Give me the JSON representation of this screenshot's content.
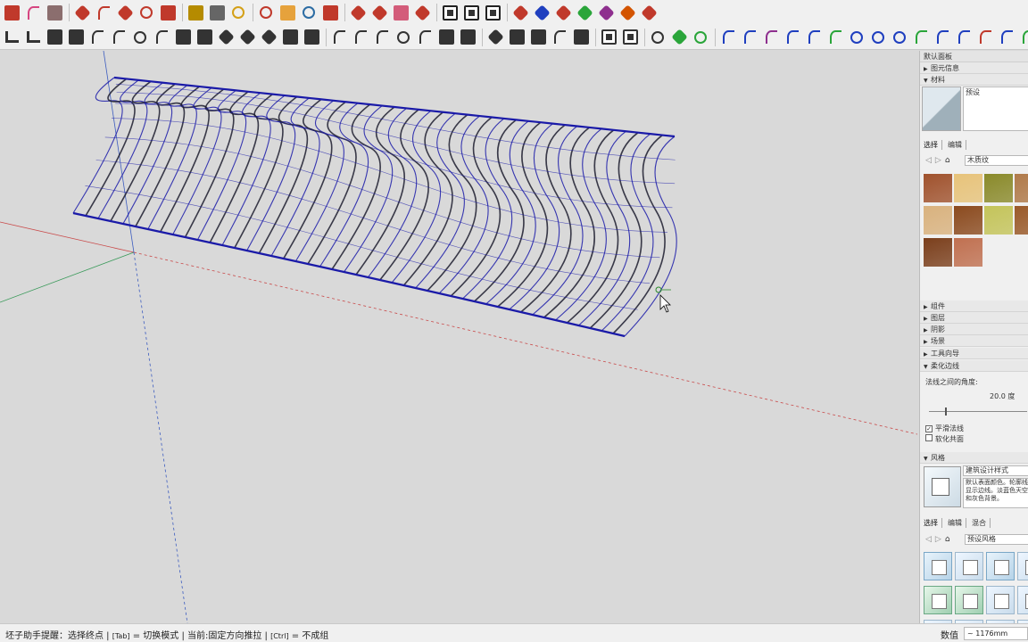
{
  "toolbar_row1": [
    {
      "name": "pencil-icon",
      "color": "#c0392b",
      "shape": "sq"
    },
    {
      "name": "arc-icon",
      "color": "#d64580",
      "shape": "curve"
    },
    {
      "name": "eraser-icon",
      "color": "#8b6e6e",
      "shape": "sq"
    },
    {
      "sep": true
    },
    {
      "name": "push-pull-icon",
      "color": "#c0392b",
      "shape": "gem"
    },
    {
      "name": "follow-me-icon",
      "color": "#c0392b",
      "shape": "curve"
    },
    {
      "name": "move-icon",
      "color": "#c0392b",
      "shape": "gem"
    },
    {
      "name": "rotate-icon",
      "color": "#c0392b",
      "shape": "ring"
    },
    {
      "name": "scale-icon",
      "color": "#c0392b",
      "shape": "sq"
    },
    {
      "sep": true
    },
    {
      "name": "tape-measure-icon",
      "color": "#b58b00",
      "shape": "sq"
    },
    {
      "name": "text-icon",
      "color": "#666666",
      "shape": "sq"
    },
    {
      "name": "paint-bucket-icon",
      "color": "#d4a017",
      "shape": "ring"
    },
    {
      "sep": true
    },
    {
      "name": "orbit-icon",
      "color": "#c0392b",
      "shape": "ring"
    },
    {
      "name": "pan-icon",
      "color": "#e6a23c",
      "shape": "sq"
    },
    {
      "name": "zoom-icon",
      "color": "#2c6ca3",
      "shape": "ring"
    },
    {
      "name": "zoom-extents-icon",
      "color": "#c0392b",
      "shape": "sq"
    },
    {
      "sep": true
    },
    {
      "name": "ruby-script-icon",
      "color": "#c0392b",
      "shape": "gem"
    },
    {
      "name": "ruby-console-icon",
      "color": "#c0392b",
      "shape": "gem"
    },
    {
      "name": "ruby-window-icon",
      "color": "#d35c7a",
      "shape": "sq"
    },
    {
      "name": "ruby-gem-icon",
      "color": "#c0392b",
      "shape": "gem"
    },
    {
      "sep": true
    },
    {
      "name": "grid-view-icon",
      "color": "#222222",
      "shape": "boxed"
    },
    {
      "name": "ring-view-icon",
      "color": "#222222",
      "shape": "boxed"
    },
    {
      "name": "model-view-icon",
      "color": "#222222",
      "shape": "boxed"
    },
    {
      "sep": true
    },
    {
      "name": "extension-1-icon",
      "color": "#c0392b",
      "shape": "gem"
    },
    {
      "name": "extension-2-icon",
      "color": "#1f3fbf",
      "shape": "gem"
    },
    {
      "name": "extension-3-icon",
      "color": "#c0392b",
      "shape": "gem"
    },
    {
      "name": "extension-4-icon",
      "color": "#2aa53a",
      "shape": "gem"
    },
    {
      "name": "extension-5-icon",
      "color": "#8e2f8e",
      "shape": "gem"
    },
    {
      "name": "extension-6-icon",
      "color": "#d35400",
      "shape": "gem"
    },
    {
      "name": "extension-7-icon",
      "color": "#c0392b",
      "shape": "gem"
    }
  ],
  "toolbar_row2": [
    {
      "name": "line-tool-icon",
      "color": "#333333",
      "shape": "bars"
    },
    {
      "name": "bar-chart-icon",
      "color": "#333333",
      "shape": "bars"
    },
    {
      "name": "align-icon",
      "color": "#333333",
      "shape": "sq"
    },
    {
      "name": "distribute-icon",
      "color": "#333333",
      "shape": "sq"
    },
    {
      "name": "curve-icon",
      "color": "#333333",
      "shape": "curve"
    },
    {
      "name": "bezier-icon",
      "color": "#333333",
      "shape": "curve"
    },
    {
      "name": "loop-icon",
      "color": "#333333",
      "shape": "ring"
    },
    {
      "name": "join-icon",
      "color": "#333333",
      "shape": "curve"
    },
    {
      "name": "stack-icon",
      "color": "#333333",
      "shape": "sq"
    },
    {
      "name": "offset-icon",
      "color": "#333333",
      "shape": "sq"
    },
    {
      "name": "split-icon",
      "color": "#333333",
      "shape": "gem"
    },
    {
      "name": "layers-icon",
      "color": "#333333",
      "shape": "gem"
    },
    {
      "name": "array-icon",
      "color": "#333333",
      "shape": "gem"
    },
    {
      "name": "box-icon",
      "color": "#333333",
      "shape": "sq"
    },
    {
      "name": "bucket-icon",
      "color": "#333333",
      "shape": "sq"
    },
    {
      "sep": true
    },
    {
      "name": "arch-icon",
      "color": "#333333",
      "shape": "curve"
    },
    {
      "name": "wave-icon",
      "color": "#333333",
      "shape": "curve"
    },
    {
      "name": "spline-icon",
      "color": "#333333",
      "shape": "curve"
    },
    {
      "name": "spiral-icon",
      "color": "#333333",
      "shape": "ring"
    },
    {
      "name": "sweep-icon",
      "color": "#333333",
      "shape": "curve"
    },
    {
      "name": "extrude-icon",
      "color": "#333333",
      "shape": "sq"
    },
    {
      "name": "column-icon",
      "color": "#333333",
      "shape": "sq"
    },
    {
      "sep": true
    },
    {
      "name": "pyramid-icon",
      "color": "#333333",
      "shape": "gem"
    },
    {
      "name": "grid-points-icon",
      "color": "#333333",
      "shape": "sq"
    },
    {
      "name": "cube-icon",
      "color": "#333333",
      "shape": "sq"
    },
    {
      "name": "compass-icon",
      "color": "#333333",
      "shape": "curve"
    },
    {
      "name": "brush-icon",
      "color": "#333333",
      "shape": "sq"
    },
    {
      "sep": true
    },
    {
      "name": "phone-icon",
      "color": "#333333",
      "shape": "boxed"
    },
    {
      "name": "shield-icon",
      "color": "#333333",
      "shape": "boxed"
    },
    {
      "sep": true
    },
    {
      "name": "cup-icon",
      "color": "#333333",
      "shape": "ring"
    },
    {
      "name": "drop-icon",
      "color": "#2aa53a",
      "shape": "gem"
    },
    {
      "name": "leaf-icon",
      "color": "#2aa53a",
      "shape": "ring"
    },
    {
      "sep": true
    },
    {
      "name": "curve-a-icon",
      "color": "#1f3fbf",
      "shape": "curve"
    },
    {
      "name": "curve-b-icon",
      "color": "#1f3fbf",
      "shape": "curve"
    },
    {
      "name": "curve-c-icon",
      "color": "#8e2f8e",
      "shape": "curve"
    },
    {
      "name": "curve-d-icon",
      "color": "#1f3fbf",
      "shape": "curve"
    },
    {
      "name": "curve-e-icon",
      "color": "#1f3fbf",
      "shape": "curve"
    },
    {
      "name": "arc-blue-icon",
      "color": "#2aa53a",
      "shape": "curve"
    },
    {
      "name": "square-outline-icon",
      "color": "#1f3fbf",
      "shape": "ring"
    },
    {
      "name": "circle-outline-icon",
      "color": "#1f3fbf",
      "shape": "ring"
    },
    {
      "name": "target-icon",
      "color": "#1f3fbf",
      "shape": "ring"
    },
    {
      "name": "curve-f-icon",
      "color": "#2aa53a",
      "shape": "curve"
    },
    {
      "name": "curve-g-icon",
      "color": "#1f3fbf",
      "shape": "curve"
    },
    {
      "name": "curve-h-icon",
      "color": "#1f3fbf",
      "shape": "curve"
    },
    {
      "name": "curve-i-icon",
      "color": "#c0392b",
      "shape": "curve"
    },
    {
      "name": "curve-j-icon",
      "color": "#1f3fbf",
      "shape": "curve"
    },
    {
      "name": "curve-k-icon",
      "color": "#2aa53a",
      "shape": "curve"
    },
    {
      "name": "wrench-icon",
      "color": "#2aa53a",
      "shape": "sq"
    },
    {
      "name": "oval-icon",
      "color": "#c0392b",
      "shape": "ring"
    }
  ],
  "tray": {
    "header": "默认面板",
    "entity_info": "图元信息",
    "materials": "材料",
    "material_name": "预设",
    "tab_select": "选择",
    "tab_edit": "编辑",
    "material_category": "木质纹",
    "material_colors": [
      "#a0522d",
      "#e7c37a",
      "#8a8a2a",
      "#b07a4a",
      "#d9b27e",
      "#8b4a1e",
      "#c4c45a",
      "#9a5a2a",
      "#7b3f1c",
      "#c07050"
    ],
    "components": "组件",
    "layers": "图层",
    "shadows": "阴影",
    "scenes": "场景",
    "instructor": "工具向导",
    "soften_edges": "柔化边线",
    "angle_label": "法线之间的角度:",
    "angle_value": "20.0",
    "angle_unit": "度",
    "smooth_normals": "平滑法线",
    "soften_coplanar": "软化共面",
    "styles": "风格",
    "style_name": "建筑设计样式",
    "style_desc": "默认表面颜色。轮廓线显示边线。淡蓝色天空和灰色背景。",
    "tab_mix": "混合",
    "style_category": "预设风格"
  },
  "status": {
    "text_main": "坯子助手提醒：选择终点 | ",
    "text_tab": "[Tab]",
    "text_mode": " = 切换模式 | 当前:固定方向推拉 | ",
    "text_ctrl": "[Ctrl]",
    "text_group": " = 不成组",
    "measure_label": "数值",
    "measure_value": "~ 1176mm"
  },
  "colors": {
    "mesh_blue": "#1a1aa8",
    "mesh_dark": "#1c1c2e",
    "axis_red": "#c94a4a",
    "axis_green": "#3a9a5a",
    "background": "#d9d9d9"
  }
}
